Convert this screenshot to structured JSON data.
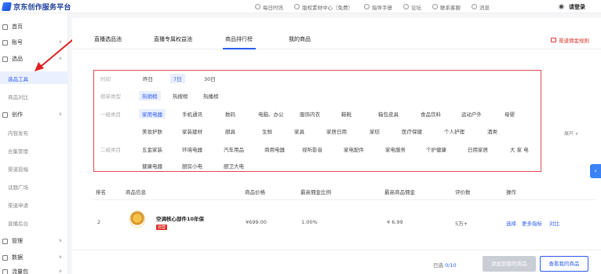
{
  "header": {
    "logo_text": "京东创作服务平台",
    "nav": [
      {
        "label": "每日时讯",
        "icon": "news-icon"
      },
      {
        "label": "版权素材中心（免费）",
        "icon": "image-icon"
      },
      {
        "label": "指导手册",
        "icon": "book-icon"
      },
      {
        "label": "论坛",
        "icon": "forum-icon"
      },
      {
        "label": "联系客服",
        "icon": "service-icon"
      },
      {
        "label": "消息",
        "icon": "bell-icon"
      }
    ],
    "login": "请登录"
  },
  "sidebar": {
    "items": [
      {
        "label": "首页",
        "icon": "home-icon"
      },
      {
        "label": "账号",
        "icon": "user-icon",
        "chevron": "∨"
      },
      {
        "label": "选品",
        "icon": "select-icon",
        "chevron": "∧"
      },
      {
        "label": "创作",
        "icon": "create-icon",
        "chevron": "∧"
      },
      {
        "label": "管理",
        "icon": "manage-icon",
        "chevron": "∨"
      },
      {
        "label": "数据",
        "icon": "data-icon",
        "chevron": "∨"
      },
      {
        "label": "流量包",
        "icon": "traffic-icon",
        "chevron": "∨"
      }
    ],
    "sub_select": [
      "选品工具",
      "商品对比"
    ],
    "sub_create": [
      "内容发布",
      "合集管理",
      "渠道投稿",
      "话题广场",
      "渠道申请",
      "直播后台"
    ]
  },
  "tabs": [
    "直播选品池",
    "直播专属权益池",
    "商品排行榜",
    "我的商品"
  ],
  "rule_link": "渠道佣金规则",
  "filter": {
    "time_label": "时间",
    "time_opts": [
      "昨日",
      "7日",
      "30日"
    ],
    "list_label": "榜单类型",
    "list_opts": [
      "热销榜",
      "热搜榜",
      "热播榜"
    ],
    "cat1_label": "一级类目",
    "cat1_row1": [
      "家用电器",
      "手机通讯",
      "数码",
      "电脑、办公",
      "服饰内衣",
      "鞋靴",
      "箱包皮具",
      "食品饮料",
      "运动户外",
      "母婴"
    ],
    "cat1_row2": [
      "美妆护肤",
      "家装建材",
      "厨具",
      "生鲜",
      "家具",
      "家居日用",
      "家纺",
      "医疗保健",
      "个人护理",
      "酒类"
    ],
    "cat2_label": "二级类目",
    "cat2_row1": [
      "五金家装",
      "环境电器",
      "汽车用品",
      "商用电器",
      "视听影音",
      "家电配件",
      "家电服务",
      "个护健康",
      "日用家居",
      "大 家 电"
    ],
    "cat2_row2": [
      "健康电器",
      "厨房小电",
      "厨卫大电"
    ],
    "expand": "展开"
  },
  "table": {
    "headers": [
      "排名",
      "商品信息",
      "商品价格",
      "最高佣金比例",
      "最高商品佣金",
      "评价数",
      "操作"
    ],
    "rows": [
      {
        "rank": "2",
        "title": "空调核心部件10年保",
        "tag": "自营",
        "price": "¥699.00",
        "rate": "1.00%",
        "commission": "¥ 6.99",
        "reviews": "5万+",
        "actions": [
          "选择",
          "更多指标",
          "对比"
        ]
      }
    ]
  },
  "footer": {
    "selected_prefix": "已选 ",
    "selected_count": "0/10",
    "add_button": "添加到我的商品",
    "view_button": "查看我的商品"
  },
  "side_tab": "‹",
  "colors": {
    "accent": "#2e5cf0",
    "highlight_border": "#e04a50",
    "arrow": "#e02020"
  }
}
